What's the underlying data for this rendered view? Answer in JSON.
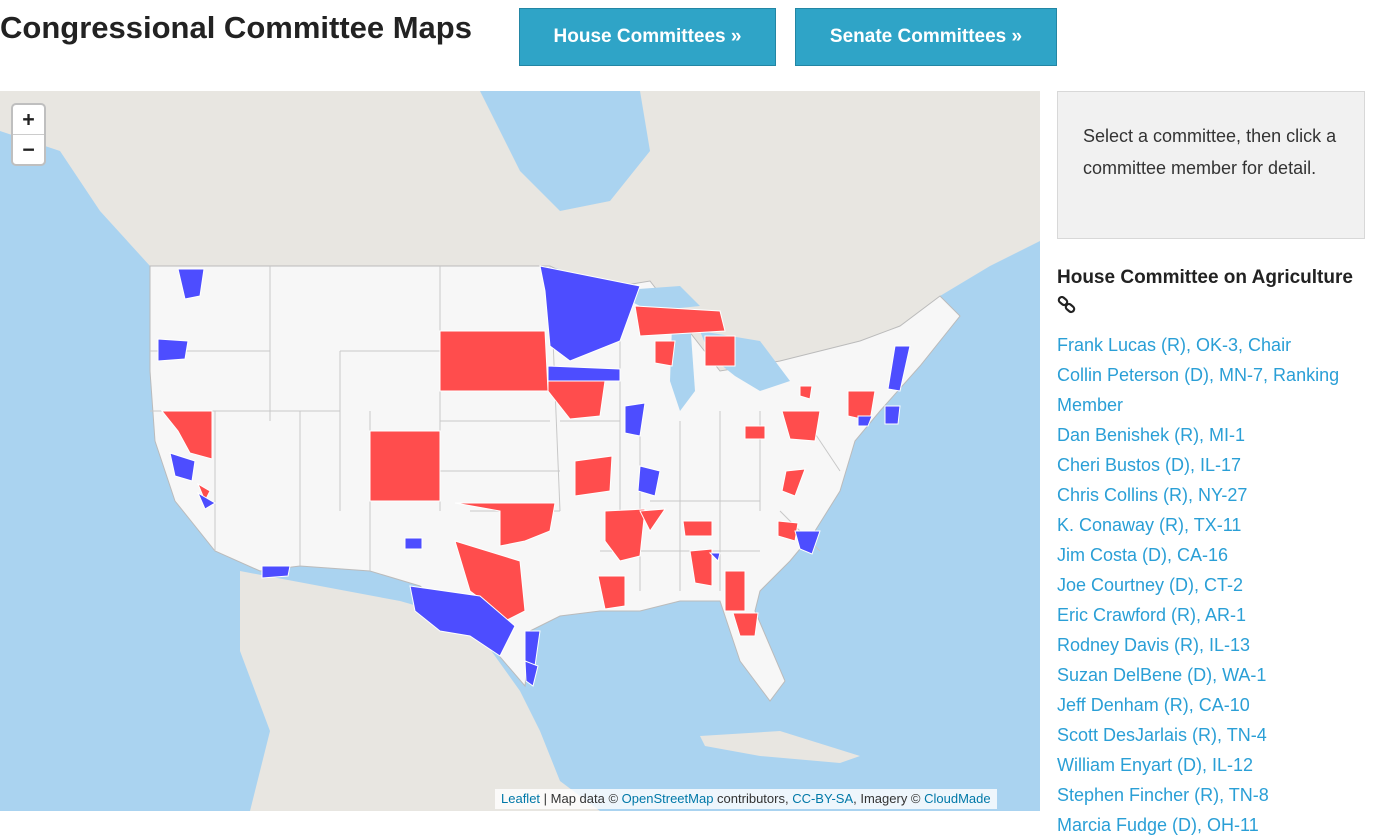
{
  "page": {
    "title": "Congressional Committee Maps"
  },
  "nav": {
    "house_label": "House Committees »",
    "senate_label": "Senate Committees »"
  },
  "map": {
    "zoom_in": "+",
    "zoom_out": "−",
    "attribution": {
      "leaflet": "Leaflet",
      "sep1": " | Map data © ",
      "osm": "OpenStreetMap",
      "sep2": " contributors, ",
      "license": "CC-BY-SA",
      "sep3": ", Imagery © ",
      "imagery": "CloudMade"
    },
    "colors": {
      "water": "#aad3f0",
      "land": "#e8e6e1",
      "us_land": "#f7f7f7",
      "republican": "#ff4d4d",
      "democrat": "#4d4dff"
    }
  },
  "sidebar": {
    "instructions": "Select a committee, then click a committee member for detail.",
    "committee_title": "House Committee on Agriculture",
    "link_icon": "link-icon",
    "members": [
      "Frank Lucas (R), OK-3, Chair",
      "Collin Peterson (D), MN-7, Ranking Member",
      "Dan Benishek (R), MI-1",
      "Cheri Bustos (D), IL-17",
      "Chris Collins (R), NY-27",
      "K. Conaway (R), TX-11",
      "Jim Costa (D), CA-16",
      "Joe Courtney (D), CT-2",
      "Eric Crawford (R), AR-1",
      "Rodney Davis (R), IL-13",
      "Suzan DelBene (D), WA-1",
      "Jeff Denham (R), CA-10",
      "Scott DesJarlais (R), TN-4",
      "William Enyart (D), IL-12",
      "Stephen Fincher (R), TN-8",
      "Marcia Fudge (D), OH-11"
    ]
  }
}
